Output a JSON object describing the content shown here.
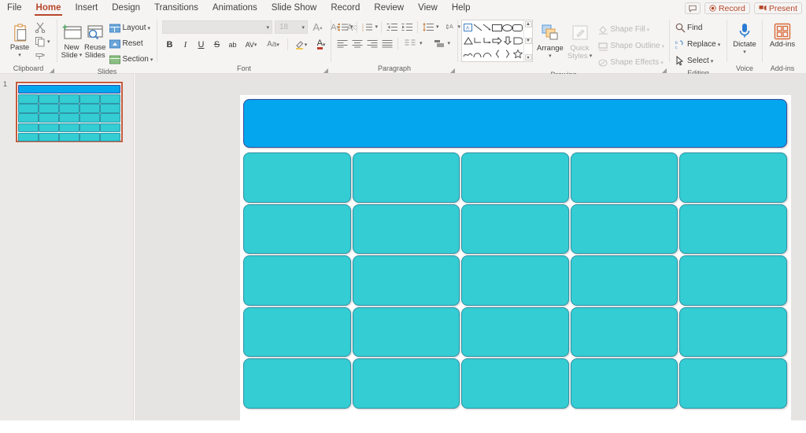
{
  "app": {
    "name": "PowerPoint"
  },
  "tabs": [
    {
      "label": "File",
      "active": false
    },
    {
      "label": "Home",
      "active": true
    },
    {
      "label": "Insert",
      "active": false
    },
    {
      "label": "Design",
      "active": false
    },
    {
      "label": "Transitions",
      "active": false
    },
    {
      "label": "Animations",
      "active": false
    },
    {
      "label": "Slide Show",
      "active": false
    },
    {
      "label": "Record",
      "active": false
    },
    {
      "label": "Review",
      "active": false
    },
    {
      "label": "View",
      "active": false
    },
    {
      "label": "Help",
      "active": false
    }
  ],
  "titlebar_actions": {
    "comment_icon": "comment-icon",
    "record_label": "Record",
    "record_icon": "record-dot-icon",
    "present_label": "Present",
    "present_icon": "present-icon"
  },
  "ribbon": {
    "groups": [
      {
        "name": "Clipboard",
        "label": "Clipboard",
        "has_dialog_launcher": true
      },
      {
        "name": "Slides",
        "label": "Slides",
        "has_dialog_launcher": false
      },
      {
        "name": "Font",
        "label": "Font",
        "has_dialog_launcher": true
      },
      {
        "name": "Paragraph",
        "label": "Paragraph",
        "has_dialog_launcher": true
      },
      {
        "name": "Drawing",
        "label": "Drawing",
        "has_dialog_launcher": true
      },
      {
        "name": "Editing",
        "label": "Editing",
        "has_dialog_launcher": false
      },
      {
        "name": "Voice",
        "label": "Voice",
        "has_dialog_launcher": false
      },
      {
        "name": "Add-ins",
        "label": "Add-ins",
        "has_dialog_launcher": false
      }
    ],
    "clipboard": {
      "paste_label": "Paste",
      "cut_icon": "scissors-icon",
      "copy_icon": "copy-icon",
      "format_painter_icon": "format-painter-icon"
    },
    "slides": {
      "new_slide_label": "New\nSlide",
      "new_slide_line1": "New",
      "new_slide_line2": "Slide",
      "reuse_slides_line1": "Reuse",
      "reuse_slides_line2": "Slides",
      "layout_label": "Layout",
      "reset_label": "Reset",
      "section_label": "Section"
    },
    "font": {
      "font_name_value": "",
      "font_name_placeholder": "",
      "font_size_value": "18",
      "increase_font_label": "A",
      "decrease_font_label": "A",
      "clear_formatting_label": "A",
      "bold_label": "B",
      "italic_label": "I",
      "underline_label": "U",
      "strikethrough_label": "S",
      "shadow_label": "ab",
      "char_spacing_label": "AV",
      "change_case_label": "Aa",
      "highlight_label": "✎",
      "font_color_label": "A"
    },
    "paragraph": {
      "bullets_icon": "bullet-list-icon",
      "numbering_icon": "numbered-list-icon",
      "decrease_indent_icon": "decrease-indent-icon",
      "increase_indent_icon": "increase-indent-icon",
      "line_spacing_icon": "line-spacing-icon",
      "text_direction_icon": "text-direction-icon",
      "align_text_icon": "align-text-icon",
      "smartart_icon": "convert-to-smartart-icon",
      "align_left_icon": "align-left-icon",
      "align_center_icon": "align-center-icon",
      "align_right_icon": "align-right-icon",
      "justify_icon": "justify-icon",
      "columns_icon": "columns-icon"
    },
    "drawing": {
      "shapes_gallery_name": "shapes-gallery",
      "arrange_label": "Arrange",
      "quick_styles_line1": "Quick",
      "quick_styles_line2": "Styles",
      "shape_fill_label": "Shape Fill",
      "shape_outline_label": "Shape Outline",
      "shape_effects_label": "Shape Effects",
      "shapes": [
        "textbox-shape",
        "line-shape",
        "line-arrow-shape",
        "rectangle-shape",
        "oval-shape",
        "rounded-rectangle-shape",
        "triangle-shape",
        "elbow-connector-shape",
        "elbow-arrow-shape",
        "right-arrow-shape",
        "down-arrow-shape",
        "flowchart-shape",
        "scribble-shape",
        "curve-shape",
        "arc-shape",
        "left-brace-shape",
        "right-brace-shape",
        "star-shape"
      ]
    },
    "editing": {
      "find_label": "Find",
      "find_icon": "search-icon",
      "replace_label": "Replace",
      "replace_icon": "replace-icon",
      "select_label": "Select",
      "select_icon": "cursor-select-icon"
    },
    "voice": {
      "dictate_label": "Dictate",
      "dictate_icon": "microphone-icon"
    },
    "addins": {
      "addins_label": "Add-ins",
      "addins_icon": "addins-grid-icon"
    }
  },
  "slide_pane": {
    "slides": [
      {
        "number": "1",
        "selected": true
      }
    ]
  },
  "slide_canvas": {
    "banner": {
      "name": "title-banner-shape",
      "fill": "#04A6ED",
      "outline": "#3A4A9E",
      "text": ""
    },
    "grid": {
      "rows": 5,
      "cols": 5,
      "cell_fill": "#33CDD3",
      "cell_outline": "#2F93A6",
      "cells": [
        [
          "",
          "",
          "",
          "",
          ""
        ],
        [
          "",
          "",
          "",
          "",
          ""
        ],
        [
          "",
          "",
          "",
          "",
          ""
        ],
        [
          "",
          "",
          "",
          "",
          ""
        ],
        [
          "",
          "",
          "",
          "",
          ""
        ]
      ]
    }
  }
}
